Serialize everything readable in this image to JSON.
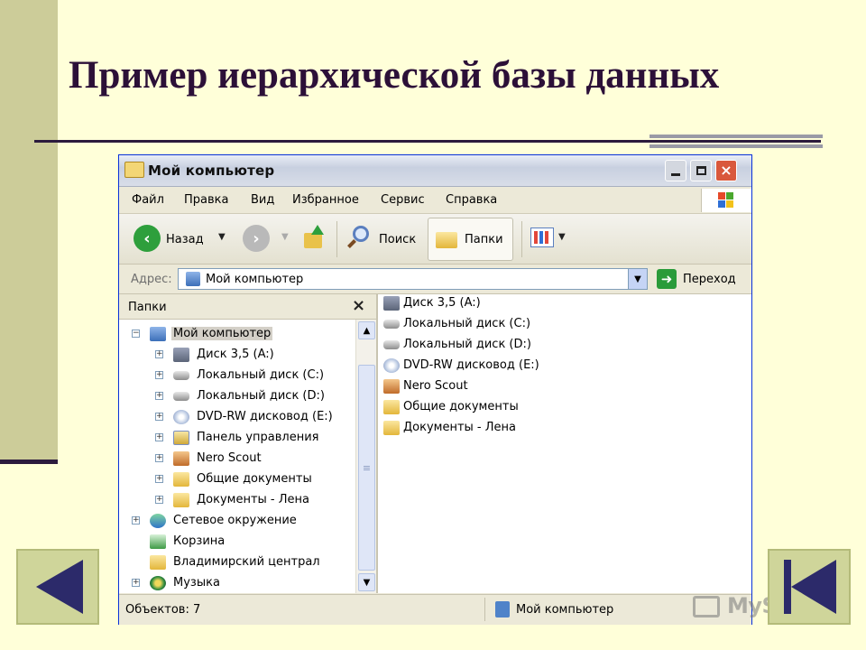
{
  "slide": {
    "title": "Пример иерархической базы данных",
    "nav": {
      "prev_icon": "previous-slide-icon",
      "last_icon": "last-slide-icon"
    },
    "watermark": "MyShared"
  },
  "window": {
    "title": "Мой компьютер",
    "buttons": {
      "minimize": "minimize-icon",
      "maximize": "maximize-icon",
      "close": "×"
    },
    "menu": [
      "Файл",
      "Правка",
      "Вид",
      "Избранное",
      "Сервис",
      "Справка"
    ],
    "toolbar": {
      "back_label": "Назад",
      "search_label": "Поиск",
      "folders_label": "Папки",
      "back_arrow": "‹",
      "forward_arrow": "›"
    },
    "address": {
      "label": "Адрес:",
      "value": "Мой компьютер",
      "go_label": "Переход",
      "go_arrow": "➜"
    },
    "folders_pane": {
      "header": "Папки",
      "close": "×",
      "tree": [
        {
          "label": "Мой компьютер",
          "toggle": "−",
          "level": 0,
          "icon": "computer-icon",
          "selected": true
        },
        {
          "label": "Диск 3,5 (A:)",
          "toggle": "+",
          "level": 1,
          "icon": "floppy-icon"
        },
        {
          "label": "Локальный диск (C:)",
          "toggle": "+",
          "level": 1,
          "icon": "disk-icon"
        },
        {
          "label": "Локальный диск (D:)",
          "toggle": "+",
          "level": 1,
          "icon": "disk-icon"
        },
        {
          "label": "DVD-RW дисковод (E:)",
          "toggle": "+",
          "level": 1,
          "icon": "dvd-icon"
        },
        {
          "label": "Панель управления",
          "toggle": "+",
          "level": 1,
          "icon": "control-panel-icon"
        },
        {
          "label": "Nero Scout",
          "toggle": "+",
          "level": 1,
          "icon": "nero-scout-icon"
        },
        {
          "label": "Общие документы",
          "toggle": "+",
          "level": 1,
          "icon": "folder-icon"
        },
        {
          "label": "Документы - Лена",
          "toggle": "+",
          "level": 1,
          "icon": "folder-icon"
        },
        {
          "label": "Сетевое окружение",
          "toggle": "+",
          "level": 0,
          "icon": "network-icon"
        },
        {
          "label": "Корзина",
          "toggle": "",
          "level": 0,
          "icon": "recycle-bin-icon"
        },
        {
          "label": "Владимирский централ",
          "toggle": "",
          "level": 0,
          "icon": "folder-icon"
        },
        {
          "label": "Музыка",
          "toggle": "+",
          "level": 0,
          "icon": "music-icon"
        }
      ]
    },
    "content_items": [
      {
        "label": "Диск 3,5 (A:)",
        "icon": "floppy-icon"
      },
      {
        "label": "Локальный диск (C:)",
        "icon": "disk-icon"
      },
      {
        "label": "Локальный диск (D:)",
        "icon": "disk-icon"
      },
      {
        "label": "DVD-RW дисковод (E:)",
        "icon": "dvd-icon"
      },
      {
        "label": "Nero Scout",
        "icon": "nero-scout-icon"
      },
      {
        "label": "Общие документы",
        "icon": "folder-icon"
      },
      {
        "label": "Документы - Лена",
        "icon": "folder-icon"
      }
    ],
    "status": {
      "objects": "Объектов: 7",
      "location": "Мой компьютер"
    }
  }
}
